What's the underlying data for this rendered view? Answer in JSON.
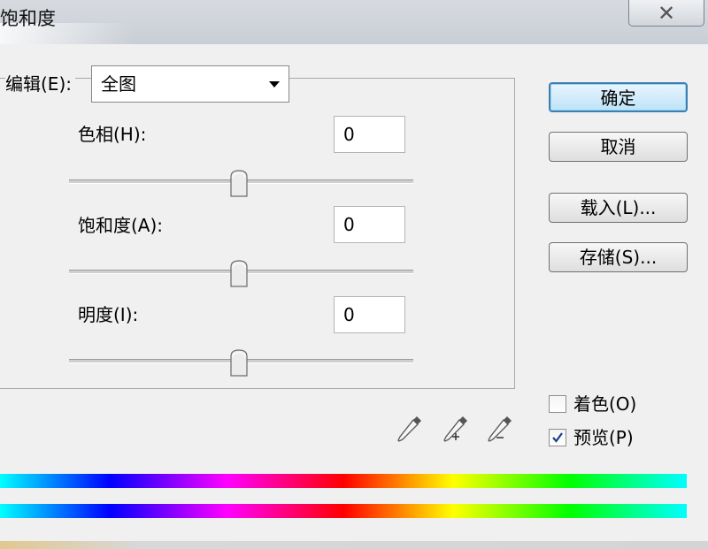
{
  "window": {
    "title": "饱和度",
    "close_glyph": "✕"
  },
  "edit": {
    "label": "编辑(E):",
    "selected": "全图"
  },
  "fields": [
    {
      "label": "色相(H):",
      "value": "0",
      "slider_value": 0
    },
    {
      "label": "饱和度(A):",
      "value": "0",
      "slider_value": 0
    },
    {
      "label": "明度(I):",
      "value": "0",
      "slider_value": 0
    }
  ],
  "buttons": {
    "ok": "确定",
    "cancel": "取消",
    "load": "载入(L)...",
    "save": "存储(S)..."
  },
  "options": {
    "colorize": {
      "label": "着色(O)",
      "checked": false
    },
    "preview": {
      "label": "预览(P)",
      "checked": true
    }
  },
  "icons": {
    "eyedropper": "eyedropper-icon",
    "eyedropper_add": "eyedropper-plus-icon",
    "eyedropper_subtract": "eyedropper-minus-icon"
  },
  "colors": {
    "default_button_border": "#3c7fb1",
    "default_button_fill": "#bde3f8"
  }
}
